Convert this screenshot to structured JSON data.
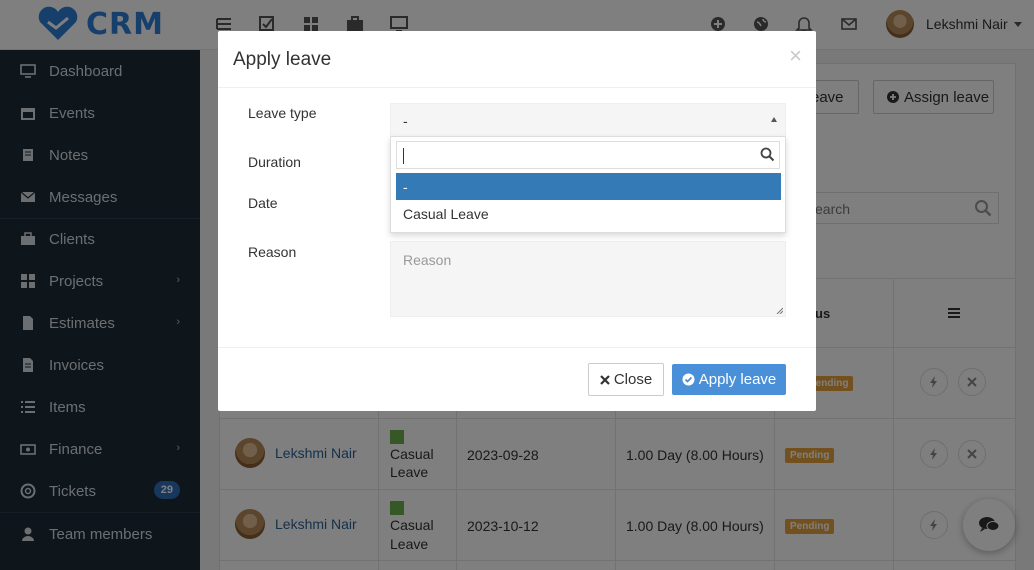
{
  "app": {
    "logo_text": "CRM"
  },
  "topbar": {
    "user_name": "Lekshmi Nair"
  },
  "sidebar": {
    "items": [
      {
        "label": "Dashboard"
      },
      {
        "label": "Events"
      },
      {
        "label": "Notes"
      },
      {
        "label": "Messages"
      },
      {
        "label": "Clients"
      },
      {
        "label": "Projects"
      },
      {
        "label": "Estimates"
      },
      {
        "label": "Invoices"
      },
      {
        "label": "Items"
      },
      {
        "label": "Finance"
      },
      {
        "label": "Tickets",
        "badge": "29"
      },
      {
        "label": "Team members"
      }
    ]
  },
  "page": {
    "apply_partial_label": "eave",
    "assign_leave_label": "Assign leave",
    "search_placeholder": "earch",
    "status_header": "us",
    "rows": [
      {
        "name": "Lekshmi Nair",
        "leave_type_line1": "Casual",
        "leave_type_line2": "Leave",
        "date": "2023-09-28",
        "duration": "1.00 Day (8.00 Hours)",
        "status": "Pending"
      },
      {
        "name": "Lekshmi Nair",
        "leave_type_line1": "Casual",
        "leave_type_line2": "Leave",
        "date": "2023-10-12",
        "duration": "1.00 Day (8.00 Hours)",
        "status": "Pending"
      }
    ],
    "partial_status": "Pending"
  },
  "modal": {
    "title": "Apply leave",
    "close_x": "×",
    "labels": {
      "leave_type": "Leave type",
      "duration": "Duration",
      "date": "Date",
      "reason": "Reason"
    },
    "leave_type_value": "-",
    "dropdown_options": [
      "-",
      "Casual Leave"
    ],
    "reason_placeholder": "Reason",
    "close_button": "Close",
    "apply_button": "Apply leave"
  }
}
